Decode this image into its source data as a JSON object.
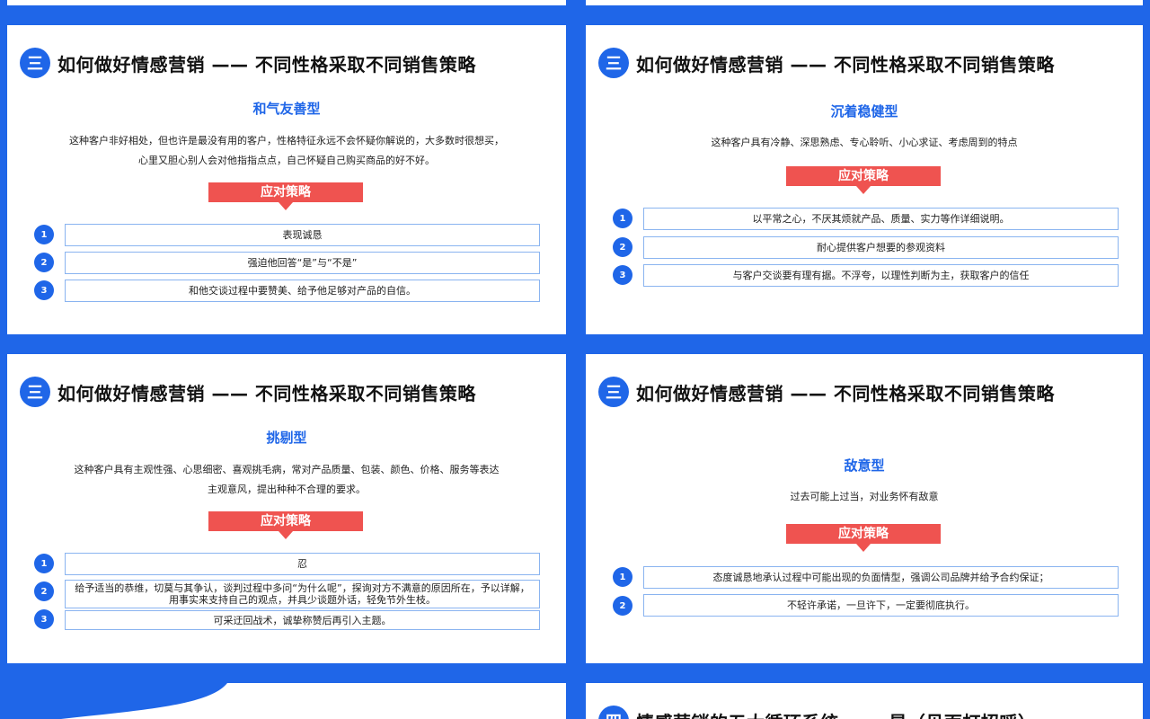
{
  "slides": [
    {
      "badge": "三",
      "title": "如何做好情感营销 —— 不同性格采取不同销售策略",
      "type": "和气友善型",
      "desc": [
        "这种客户非好相处，但也许是最没有用的客户，性格特征永远不会怀疑你解说的，大多数时很想买，",
        "心里又胆心别人会对他指指点点，自己怀疑自己购买商品的好不好。"
      ],
      "strategy": "应对策略",
      "items": [
        {
          "num": "1",
          "text": "表现诚恳"
        },
        {
          "num": "2",
          "text": "强迫他回答“是”与“不是”"
        },
        {
          "num": "3",
          "text": "和他交谈过程中要赞美、给予他足够对产品的自信。"
        }
      ]
    },
    {
      "badge": "三",
      "title": "如何做好情感营销 —— 不同性格采取不同销售策略",
      "type": "沉着稳健型",
      "desc": [
        "这种客户具有冷静、深思熟虑、专心聆听、小心求证、考虑周到的特点"
      ],
      "strategy": "应对策略",
      "items": [
        {
          "num": "1",
          "text": "以平常之心，不厌其烦就产品、质量、实力等作详细说明。"
        },
        {
          "num": "2",
          "text": "耐心提供客户想要的参观资料"
        },
        {
          "num": "3",
          "text": "与客户交谈要有理有据。不浮夸，以理性判断为主，获取客户的信任"
        }
      ]
    },
    {
      "badge": "三",
      "title": "如何做好情感营销 —— 不同性格采取不同销售策略",
      "type": "挑剔型",
      "desc": [
        "这种客户具有主观性强、心思细密、喜观挑毛病，常对产品质量、包装、颜色、价格、服务等表达",
        "主观意风，提出种种不合理的要求。"
      ],
      "strategy": "应对策略",
      "items": [
        {
          "num": "1",
          "text": "忍"
        },
        {
          "num": "2",
          "text": "给予适当的恭维，切莫与其争认，谈判过程中多问“为什么呢”，探询对方不满意的原因所在，予以详解，用事实来支持自己的观点，并具少谈题外话，轻免节外生枝。"
        },
        {
          "num": "3",
          "text": "可采迂回战术，诚挚称赞后再引入主题。"
        }
      ]
    },
    {
      "badge": "三",
      "title": "如何做好情感营销 —— 不同性格采取不同销售策略",
      "type": "敌意型",
      "desc": [
        "过去可能上过当，对业务怀有敌意"
      ],
      "strategy": "应对策略",
      "items": [
        {
          "num": "1",
          "text": "态度诚恳地承认过程中可能出现的负面情型，强调公司品牌并给予合约保证；"
        },
        {
          "num": "2",
          "text": "不轻许承诺，一旦许下，一定要彻底执行。"
        }
      ]
    }
  ],
  "partial_bottom_right": {
    "badge": "四",
    "title": "情感营销的五大循环系统 —— 是（见面打招呼）"
  },
  "colors": {
    "accent": "#1f66e8",
    "strategy": "#ef5350"
  }
}
